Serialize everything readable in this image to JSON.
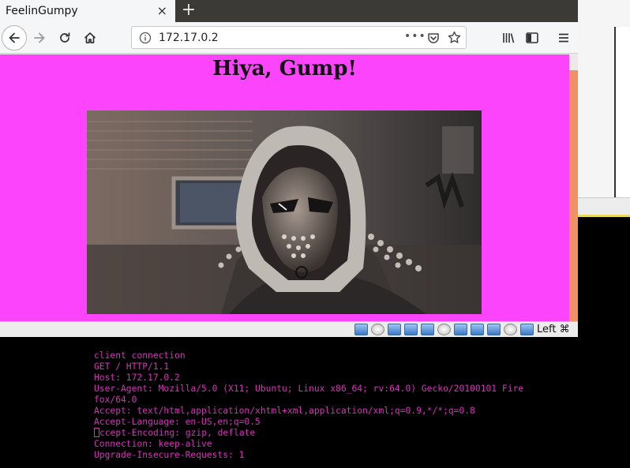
{
  "browser": {
    "tab_title": "FeelinGumpy",
    "tab_close": "×",
    "new_tab": "+",
    "url": "172.17.0.2",
    "url_more": "•••"
  },
  "page": {
    "heading": "Hiya, Gump!"
  },
  "statusbar": {
    "host_key": "Left ⌘"
  },
  "terminal": {
    "lines": [
      "client connection",
      "GET / HTTP/1.1",
      "Host: 172.17.0.2",
      "User-Agent: Mozilla/5.0 (X11; Ubuntu; Linux x86_64; rv:64.0) Gecko/20100101 Fire",
      "fox/64.0",
      "Accept: text/html,application/xhtml+xml,application/xml;q=0.9,*/*;q=0.8",
      "Accept-Language: en-US,en;q=0.5",
      "ccept-Encoding: gzip, deflate",
      "Connection: keep-alive",
      "Upgrade-Insecure-Requests: 1"
    ]
  },
  "colors": {
    "page_background": "#fb44fb",
    "terminal_text": "#d434b8",
    "scroll_thumb": "#f09064"
  },
  "icons": [
    "back-icon",
    "forward-icon",
    "reload-icon",
    "home-icon",
    "info-icon",
    "page-actions-icon",
    "pocket-icon",
    "bookmark-star-icon",
    "library-icon",
    "sidebar-icon",
    "menu-icon"
  ]
}
